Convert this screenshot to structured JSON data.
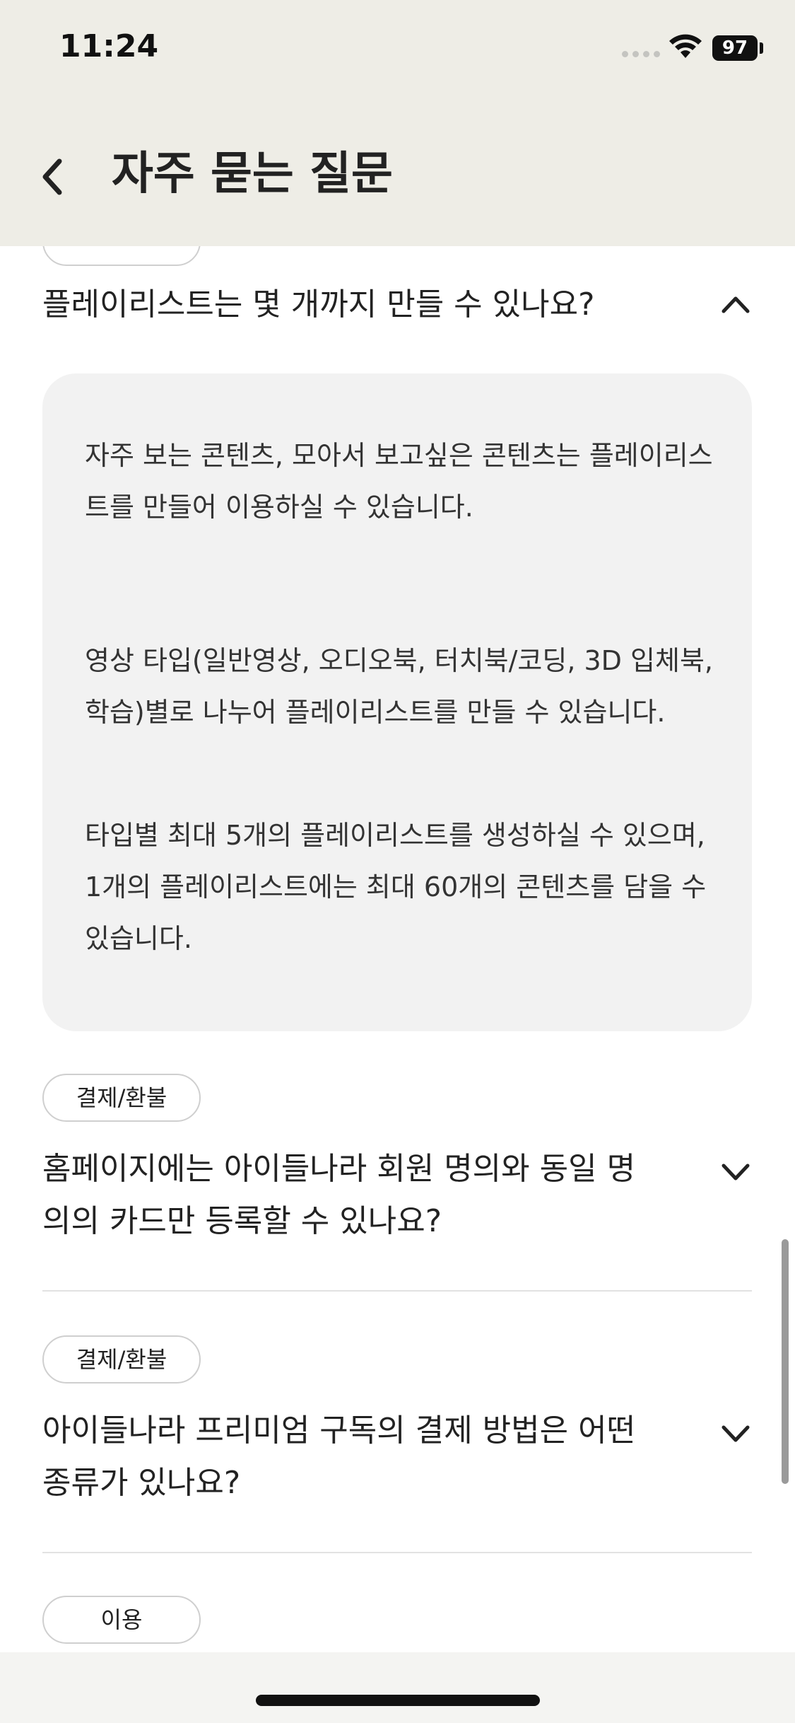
{
  "status": {
    "time": "11:24",
    "battery": "97"
  },
  "header": {
    "title": "자주 묻는 질문"
  },
  "faq": {
    "expanded": {
      "question": "플레이리스트는 몇 개까지 만들 수 있나요?",
      "answer": [
        "자주 보는 콘텐츠, 모아서 보고싶은 콘텐츠는 플레이리스트를 만들어 이용하실 수 있습니다.",
        "영상 타입(일반영상, 오디오북, 터치북/코딩, 3D 입체북, 학습)별로 나누어 플레이리스트를 만들 수 있습니다.",
        "타입별 최대 5개의 플레이리스트를 생성하실 수 있으며, 1개의 플레이리스트에는 최대 60개의 콘텐츠를 담을 수 있습니다."
      ]
    },
    "items": [
      {
        "tag": "결제/환불",
        "question": "홈페이지에는 아이들나라 회원 명의와 동일 명의의 카드만 등록할 수 있나요?"
      },
      {
        "tag": "결제/환불",
        "question": "아이들나라 프리미엄 구독의 결제 방법은 어떤 종류가 있나요?"
      },
      {
        "tag": "이용"
      }
    ]
  },
  "icons": {
    "back": "chevron-left-icon",
    "collapse": "chevron-up-icon",
    "expand": "chevron-down-icon"
  },
  "colors": {
    "header_bg": "#eeede6",
    "answer_bg": "#f2f2f2",
    "divider": "#e2e2e2"
  }
}
